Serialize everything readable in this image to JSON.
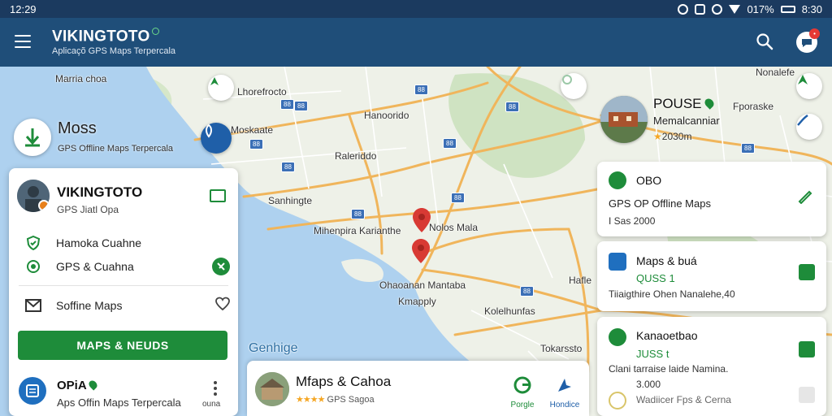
{
  "status_bar": {
    "time": "12:29",
    "battery": "017%",
    "clock": "8:30"
  },
  "app_bar": {
    "title": "VIKINGTOTO",
    "subtitle": "Aplicaçõ GPS Maps Terpercala"
  },
  "map_labels": {
    "top_left": "Marria choa",
    "l1": "Lhorefrocto",
    "l2": "Hanoorido",
    "l3": "Moskaate",
    "l4": "Raleriddo",
    "l5": "Sanhingte",
    "l6": "Mihenpira Karianthe",
    "l7": "Nolos Mala",
    "l8": "Ohaoanan Mantaba",
    "l9": "Kmapply",
    "l10": "Kolelhunfas",
    "l11": "Tokarssto",
    "l12": "Hafle",
    "l13": "Nonalefe",
    "l14": "Fporaske",
    "water": "Genhige"
  },
  "map_pins": [
    "pin-1",
    "pin-2"
  ],
  "moss_card": {
    "title": "Moss",
    "subtitle": "GPS Offline Maps Terpercala"
  },
  "left_panel": {
    "title": "VIKINGTOTO",
    "subtitle": "GPS Jiatl Opa",
    "rows": [
      {
        "label": "Hamoka Cuahne"
      },
      {
        "label": "GPS & Cuahna"
      },
      {
        "label": "Soffine Maps"
      }
    ],
    "button_label": "MAPS & NEUDS",
    "footer": {
      "title": "OPiA",
      "subtitle": "Aps Offin Maps Terpercala",
      "more_label": "ouna"
    }
  },
  "place_card": {
    "title": "Mfaps & Cahoa",
    "rating_stars": "★★★★",
    "rating_text": "GPS Sagoa",
    "actions": [
      {
        "label": "Porgle"
      },
      {
        "label": "Hondice"
      }
    ]
  },
  "right_top": {
    "title": "POUSE",
    "subtitle": "Memalcanniar",
    "meta": "2030m"
  },
  "right_cards": [
    {
      "title": "OBO",
      "line2": "GPS OP Offline Maps",
      "line3": "I Sas 2000"
    },
    {
      "title": "Maps & buá",
      "line2": "QUSS 1",
      "line3": "Tiiaigthire Ohen Nanalehe,40"
    },
    {
      "title": "Kanaoetbao",
      "line2": "JUSS t",
      "line3": "Clani tarraise laide Namina.",
      "line4": "3.000",
      "line5": "Wadiicer Fps & Cerna"
    }
  ],
  "colors": {
    "appbar": "#1f4e79",
    "status": "#1b3a5f",
    "accent_green": "#1e8c3a",
    "accent_blue": "#1f5fa8",
    "pin_red": "#d83a34",
    "water": "#aed1ef"
  }
}
